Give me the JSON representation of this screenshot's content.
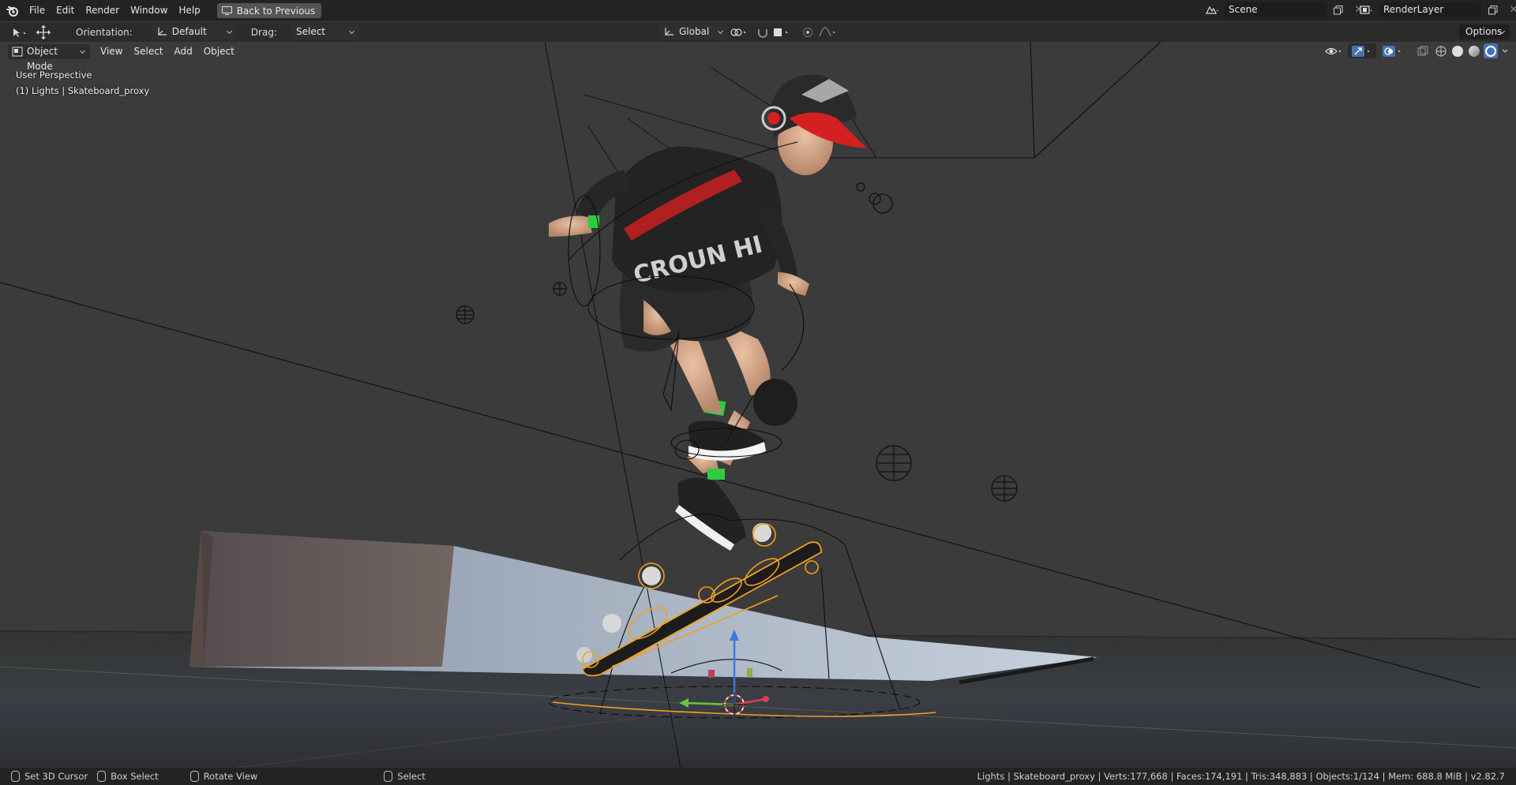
{
  "menubar": {
    "items": [
      "File",
      "Edit",
      "Render",
      "Window",
      "Help"
    ],
    "back_button": "Back to Previous",
    "scene": "Scene",
    "render_layer": "RenderLayer"
  },
  "toolbar": {
    "orientation_label": "Orientation:",
    "orientation_value": "Default",
    "drag_label": "Drag:",
    "drag_value": "Select Box",
    "transform_space": "Global",
    "options_label": "Options"
  },
  "viewport_header": {
    "mode": "Object Mode",
    "menus": [
      "View",
      "Select",
      "Add",
      "Object"
    ]
  },
  "viewport": {
    "view_name": "User Perspective",
    "active_info": "(1) Lights | Skateboard_proxy",
    "shirt_text": "CROUN HI"
  },
  "statusbar": {
    "set_cursor": "Set 3D Cursor",
    "box_select": "Box Select",
    "rotate_view": "Rotate View",
    "select": "Select",
    "stats": "Lights | Skateboard_proxy | Verts:177,668 | Faces:174,191 | Tris:348,883 | Objects:1/124 | Mem: 688.8 MiB | v2.82.7"
  },
  "colors": {
    "accent_blue": "#4772b3",
    "selection_orange": "#f0a020",
    "cap_red": "#d42020"
  }
}
